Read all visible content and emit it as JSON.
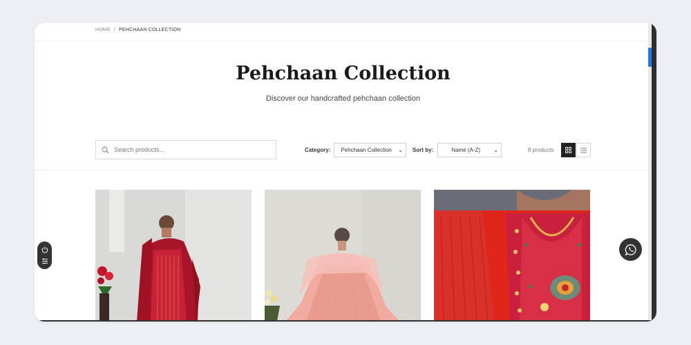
{
  "breadcrumb": {
    "home": "HOME",
    "separator": "/",
    "current": "PEHCHAAN COLLECTION"
  },
  "header": {
    "title": "Pehchaan Collection",
    "subtitle": "Discover our handcrafted pehchaan collection"
  },
  "toolbar": {
    "search_placeholder": "Search products...",
    "category_label": "Category:",
    "category_value": "Pehchaan Collection",
    "sort_label": "Sort by:",
    "sort_value": "Name (A-Z)",
    "product_count": "8 products",
    "active_view": "grid"
  },
  "products": [
    {
      "image": "woman-red-striped-suit-with-dupatta"
    },
    {
      "image": "woman-peach-anarkali-with-dupatta"
    },
    {
      "image": "red-embroidered-phulkari-neckline-closeup"
    }
  ],
  "colors": {
    "accent": "#1e7be6",
    "dark": "#222222",
    "brand_red": "#c8172b"
  },
  "icons": {
    "search": "search-icon",
    "grid_view": "grid-view-icon",
    "list_view": "list-view-icon",
    "power": "power-icon",
    "settings": "sliders-icon",
    "whatsapp": "whatsapp-icon"
  }
}
